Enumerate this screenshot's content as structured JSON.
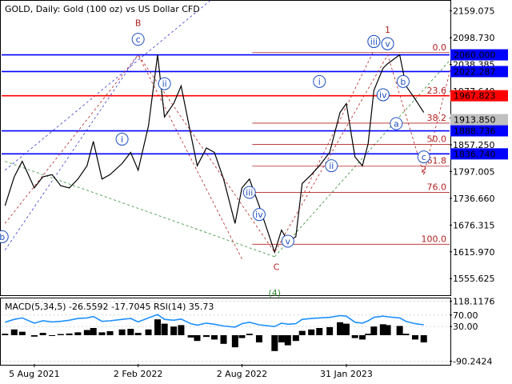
{
  "header": {
    "title": "GOLD, Daily:  Gold (100 oz) vs US Dollar CFD",
    "indicator_title": "MACD(5,34,5) -26.5592 -17.7045 RSI(14) 35.73"
  },
  "colors": {
    "price_line": "#000000",
    "blue_level": "#0000ff",
    "red_level": "#ff0000",
    "fib_line": "#b22222",
    "wave_blue": "#1f4fbf",
    "wave_red": "#b22222",
    "wave_green": "#2e8b2e",
    "channel_blue_dashed": "#3a3ad0",
    "channel_green_dashed": "#2e8b2e",
    "macd_fill": "#000000",
    "rsi_line": "#1e90ff",
    "grid": "#c0c0c0",
    "price_tag_bg": "#0000ff",
    "price_tag_red_bg": "#ff0000",
    "current_tag_bg": "#c0c0c0"
  },
  "chart_data": [
    {
      "type": "line",
      "title": "GOLD, Daily:  Gold (100 oz) vs US Dollar CFD",
      "xlabel": "",
      "ylabel": "",
      "ylim": [
        1520,
        2180
      ],
      "x_tick_labels": [
        "5 Aug 2021",
        "2 Feb 2022",
        "2 Aug 2022",
        "31 Jan 2023"
      ],
      "y_tick_labels": [
        "2159.075",
        "2098.730",
        "2038.385",
        "1977.640",
        "1917.590",
        "1857.250",
        "1797.005",
        "1736.660",
        "1676.315",
        "1615.970",
        "1555.625"
      ],
      "x": [
        "2021-06-15",
        "2021-07-01",
        "2021-07-15",
        "2021-08-05",
        "2021-08-20",
        "2021-09-05",
        "2021-09-20",
        "2021-10-05",
        "2021-10-20",
        "2021-11-05",
        "2021-11-16",
        "2021-12-01",
        "2021-12-15",
        "2022-01-05",
        "2022-01-20",
        "2022-02-02",
        "2022-02-20",
        "2022-03-08",
        "2022-03-20",
        "2022-04-05",
        "2022-04-18",
        "2022-05-05",
        "2022-05-16",
        "2022-06-01",
        "2022-06-15",
        "2022-07-01",
        "2022-07-21",
        "2022-08-02",
        "2022-08-15",
        "2022-09-01",
        "2022-09-28",
        "2022-10-10",
        "2022-10-21",
        "2022-11-04",
        "2022-11-15",
        "2022-12-01",
        "2022-12-15",
        "2023-01-02",
        "2023-01-20",
        "2023-01-31",
        "2023-02-15",
        "2023-02-28",
        "2023-03-10",
        "2023-03-20",
        "2023-04-05",
        "2023-04-13",
        "2023-05-04",
        "2023-05-15",
        "2023-05-31",
        "2023-06-15"
      ],
      "series": [
        {
          "values": [
            1720,
            1785,
            1820,
            1760,
            1785,
            1790,
            1765,
            1760,
            1780,
            1810,
            1865,
            1780,
            1790,
            1815,
            1840,
            1800,
            1900,
            2060,
            1920,
            1950,
            1990,
            1880,
            1810,
            1850,
            1840,
            1780,
            1680,
            1760,
            1780,
            1720,
            1615,
            1665,
            1640,
            1650,
            1770,
            1790,
            1810,
            1840,
            1930,
            1950,
            1830,
            1810,
            1860,
            1980,
            2030,
            2040,
            2060,
            1990,
            1960,
            1930
          ]
        }
      ],
      "wave_labels_blue_circled": [
        "c",
        "ii",
        "i",
        "b",
        "iii",
        "iv",
        "v",
        "iii",
        "iv",
        "v",
        "i",
        "ii",
        "iii",
        "iv",
        "v",
        "a",
        "b",
        "c"
      ],
      "wave_labels_red": [
        "B",
        "C",
        "1",
        "2"
      ],
      "wave_labels_green": [
        "(4)"
      ],
      "fib_levels": [
        {
          "label": "0.0",
          "value": 2065
        },
        {
          "label": "23.6",
          "value": 1967
        },
        {
          "label": "38.2",
          "value": 1906
        },
        {
          "label": "50.0",
          "value": 1858
        },
        {
          "label": "61.8",
          "value": 1809
        },
        {
          "label": "76.0",
          "value": 1750
        },
        {
          "label": "100.0",
          "value": 1633
        }
      ],
      "horizontal_levels": [
        {
          "price": "2060.000",
          "value": 2060.0,
          "color": "blue"
        },
        {
          "price": "2022.287",
          "value": 2022.287,
          "color": "blue"
        },
        {
          "price": "1967.823",
          "value": 1967.823,
          "color": "red"
        },
        {
          "price": "1888.736",
          "value": 1888.736,
          "color": "blue"
        },
        {
          "price": "1836.740",
          "value": 1836.74,
          "color": "blue"
        }
      ],
      "current_price": {
        "label": "1913.850",
        "value": 1913.85
      },
      "overlapped_tick_label": "2038.385",
      "grid": true
    },
    {
      "type": "area",
      "title": "MACD(5,34,5) -26.5592 -17.7045 RSI(14) 35.73",
      "ylim": [
        -100,
        125
      ],
      "y_tick_labels": [
        "118.1176",
        "70.00",
        "30.00",
        "-90.2424"
      ],
      "series": [
        {
          "name": "MACD",
          "values": [
            5,
            20,
            12,
            -5,
            8,
            -2,
            4,
            6,
            10,
            18,
            25,
            10,
            14,
            20,
            22,
            8,
            20,
            55,
            40,
            30,
            35,
            -8,
            -20,
            -6,
            -15,
            -30,
            -42,
            -10,
            5,
            -25,
            -55,
            -25,
            -35,
            -20,
            15,
            20,
            25,
            28,
            45,
            40,
            -10,
            -15,
            5,
            30,
            38,
            35,
            32,
            5,
            -15,
            -25
          ]
        },
        {
          "name": "RSI",
          "values": [
            45,
            55,
            60,
            42,
            50,
            46,
            48,
            52,
            58,
            60,
            65,
            48,
            50,
            55,
            58,
            46,
            60,
            72,
            55,
            52,
            56,
            40,
            35,
            42,
            38,
            32,
            28,
            40,
            45,
            36,
            30,
            42,
            38,
            40,
            55,
            58,
            60,
            62,
            68,
            66,
            45,
            42,
            50,
            62,
            66,
            64,
            60,
            48,
            40,
            36
          ]
        }
      ],
      "grid": true
    }
  ]
}
